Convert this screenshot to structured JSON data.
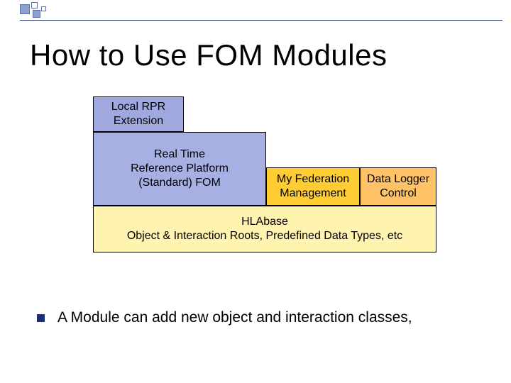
{
  "title": "How to Use FOM Modules",
  "blocks": {
    "local_rpr": "Local RPR\nExtension",
    "realtime": "Real Time\nReference Platform\n(Standard) FOM",
    "myfed": "My Federation\nManagement",
    "datalogger": "Data Logger\nControl",
    "hlabase": "HLAbase\nObject & Interaction Roots, Predefined Data Types, etc"
  },
  "bullet": "A Module can add new object and interaction classes,"
}
